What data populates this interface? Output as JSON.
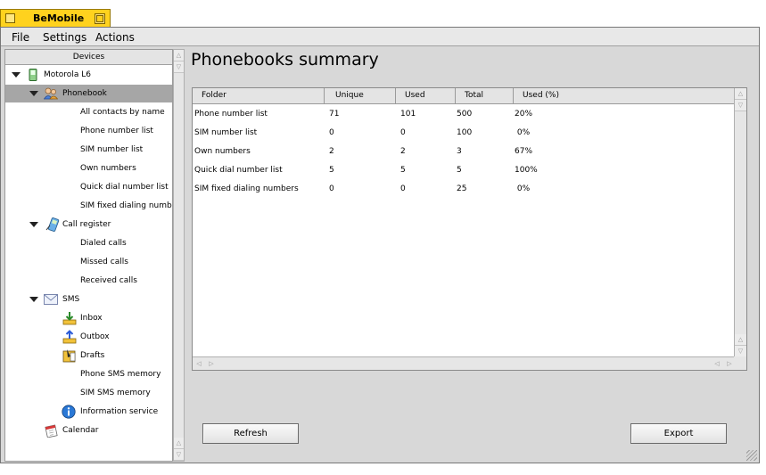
{
  "app": {
    "title": "BeMobile"
  },
  "menu": [
    "File",
    "Settings",
    "Actions"
  ],
  "sidebar": {
    "header": "Devices",
    "items": [
      {
        "label": "Motorola L6",
        "level": 0,
        "expanded": true,
        "icon": "phone-icon"
      },
      {
        "label": "Phonebook",
        "level": 1,
        "expanded": true,
        "selected": true,
        "icon": "people-icon"
      },
      {
        "label": "All contacts by name",
        "level": 2
      },
      {
        "label": "Phone number list",
        "level": 2
      },
      {
        "label": "SIM number list",
        "level": 2
      },
      {
        "label": "Own numbers",
        "level": 2
      },
      {
        "label": "Quick dial number list",
        "level": 2
      },
      {
        "label": "SIM fixed dialing numbers",
        "level": 2
      },
      {
        "label": "Call register",
        "level": 1,
        "expanded": true,
        "icon": "call-register-icon"
      },
      {
        "label": "Dialed calls",
        "level": 2
      },
      {
        "label": "Missed calls",
        "level": 2
      },
      {
        "label": "Received calls",
        "level": 2
      },
      {
        "label": "SMS",
        "level": 1,
        "expanded": true,
        "icon": "envelope-icon"
      },
      {
        "label": "Inbox",
        "level": 2,
        "icon": "inbox-icon"
      },
      {
        "label": "Outbox",
        "level": 2,
        "icon": "outbox-icon"
      },
      {
        "label": "Drafts",
        "level": 2,
        "icon": "drafts-icon"
      },
      {
        "label": "Phone SMS memory",
        "level": 2
      },
      {
        "label": "SIM SMS memory",
        "level": 2
      },
      {
        "label": "Information service",
        "level": 2,
        "icon": "info-icon"
      },
      {
        "label": "Calendar",
        "level": 1,
        "icon": "calendar-icon"
      }
    ]
  },
  "main": {
    "title": "Phonebooks summary",
    "table": {
      "columns": [
        "Folder",
        "Unique",
        "Used",
        "Total",
        "Used (%)"
      ],
      "rows": [
        [
          "Phone number list",
          "71",
          "101",
          "500",
          "20%"
        ],
        [
          "SIM number list",
          "0",
          "0",
          "100",
          " 0%"
        ],
        [
          "Own numbers",
          "2",
          "2",
          "3",
          "67%"
        ],
        [
          "Quick dial number list",
          "5",
          "5",
          "5",
          "100%"
        ],
        [
          "SIM fixed dialing numbers",
          "0",
          "0",
          "25",
          " 0%"
        ]
      ]
    },
    "refresh_label": "Refresh",
    "export_label": "Export"
  }
}
